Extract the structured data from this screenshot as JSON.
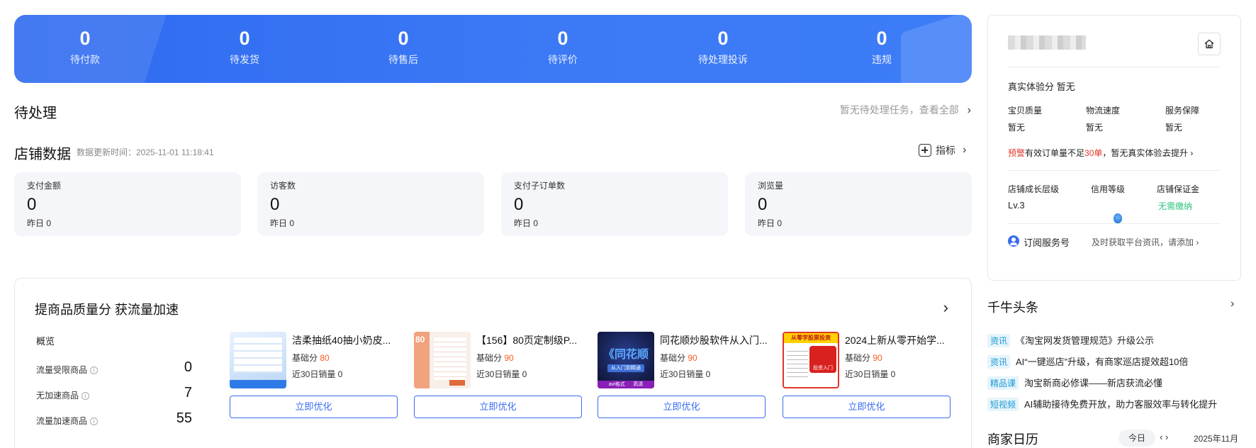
{
  "banner": {
    "stats": [
      {
        "value": "0",
        "label": "待付款"
      },
      {
        "value": "0",
        "label": "待发货"
      },
      {
        "value": "0",
        "label": "待售后"
      },
      {
        "value": "0",
        "label": "待评价"
      },
      {
        "value": "0",
        "label": "待处理投诉"
      },
      {
        "value": "0",
        "label": "违规"
      }
    ]
  },
  "pending": {
    "title": "待处理",
    "hint": "暂无待处理任务，查看全部",
    "chevron": "›"
  },
  "store_data": {
    "title": "店铺数据",
    "update_time": "数据更新时间：2025-11-01 11:18:41",
    "metrics_link": "指标",
    "chevron": "›",
    "cards": [
      {
        "title": "支付金额",
        "value": "0",
        "yesterday": "昨日 0"
      },
      {
        "title": "访客数",
        "value": "0",
        "yesterday": "昨日 0"
      },
      {
        "title": "支付子订单数",
        "value": "0",
        "yesterday": "昨日 0"
      },
      {
        "title": "浏览量",
        "value": "0",
        "yesterday": "昨日 0"
      }
    ]
  },
  "quality": {
    "title": "提商品质量分 获流量加速",
    "chevron": "›",
    "overview_title": "概览",
    "overview": [
      {
        "label": "流量受限商品",
        "value": "0"
      },
      {
        "label": "无加速商品",
        "value": "7"
      },
      {
        "label": "流量加速商品",
        "value": "55"
      }
    ],
    "info_glyph": "i",
    "score_label": "基础分",
    "products": [
      {
        "name": "洁柔抽纸40抽小奶皮...",
        "score": "80",
        "sales": "近30日销量 0",
        "button": "立即优化"
      },
      {
        "name": "【156】80页定制级P...",
        "score": "90",
        "sales": "近30日销量 0",
        "button": "立即优化"
      },
      {
        "name": "同花顺炒股软件从入门...",
        "score": "90",
        "sales": "近30日销量 0",
        "button": "立即优化"
      },
      {
        "name": "2024上新从零开始学...",
        "score": "90",
        "sales": "近30日销量 0",
        "button": "立即优化"
      }
    ],
    "thumb_text": {
      "p2": "80",
      "p3_title": "《同花顺",
      "p3_sub": "从入门到精通",
      "p3_foot": "avi格式      高清",
      "p4_banner": "从零学股票投资",
      "p4_badge": "投资入门"
    }
  },
  "side": {
    "experience_label": "真实体验分",
    "experience_value": "暂无",
    "metrics": [
      {
        "label": "宝贝质量",
        "value": "暂无"
      },
      {
        "label": "物流速度",
        "value": "暂无"
      },
      {
        "label": "服务保障",
        "value": "暂无"
      }
    ],
    "warning_tag": "预警",
    "warning_pre": "有效订单量不足",
    "warning_num": "30单",
    "warning_post": "，暂无真实体验...",
    "improve_link": "去提升 ›",
    "growth_label": "店铺成长层级",
    "growth_value": "Lv.3",
    "credit_label": "信用等级",
    "deposit_label": "店铺保证金",
    "deposit_value": "无需缴纳",
    "subscribe_label": "订阅服务号",
    "subscribe_hint": "及时获取平台资讯，请添加 ›"
  },
  "headlines": {
    "title": "千牛头条",
    "chevron": "›",
    "items": [
      {
        "tag": "资讯",
        "text": "《淘宝网发货管理规范》升级公示"
      },
      {
        "tag": "资讯",
        "text": "AI“一键巡店”升级，有商家巡店提效超10倍"
      },
      {
        "tag": "精品课",
        "text": "淘宝新商必修课——新店获流必懂"
      },
      {
        "tag": "短视频",
        "text": "AI辅助接待免费开放，助力客服效率与转化提升"
      }
    ]
  },
  "calendar": {
    "title": "商家日历",
    "today": "今日",
    "nav": "‹  ›",
    "month": "2025年11月"
  },
  "colors": {
    "banner": "#3b79f5",
    "accent": "#3a6cf2",
    "score": "#ff5a1f",
    "warning": "#e0362a",
    "green": "#2ec27e",
    "tag_bg": "#e6f4fb",
    "tag_text": "#1a9ad6"
  }
}
